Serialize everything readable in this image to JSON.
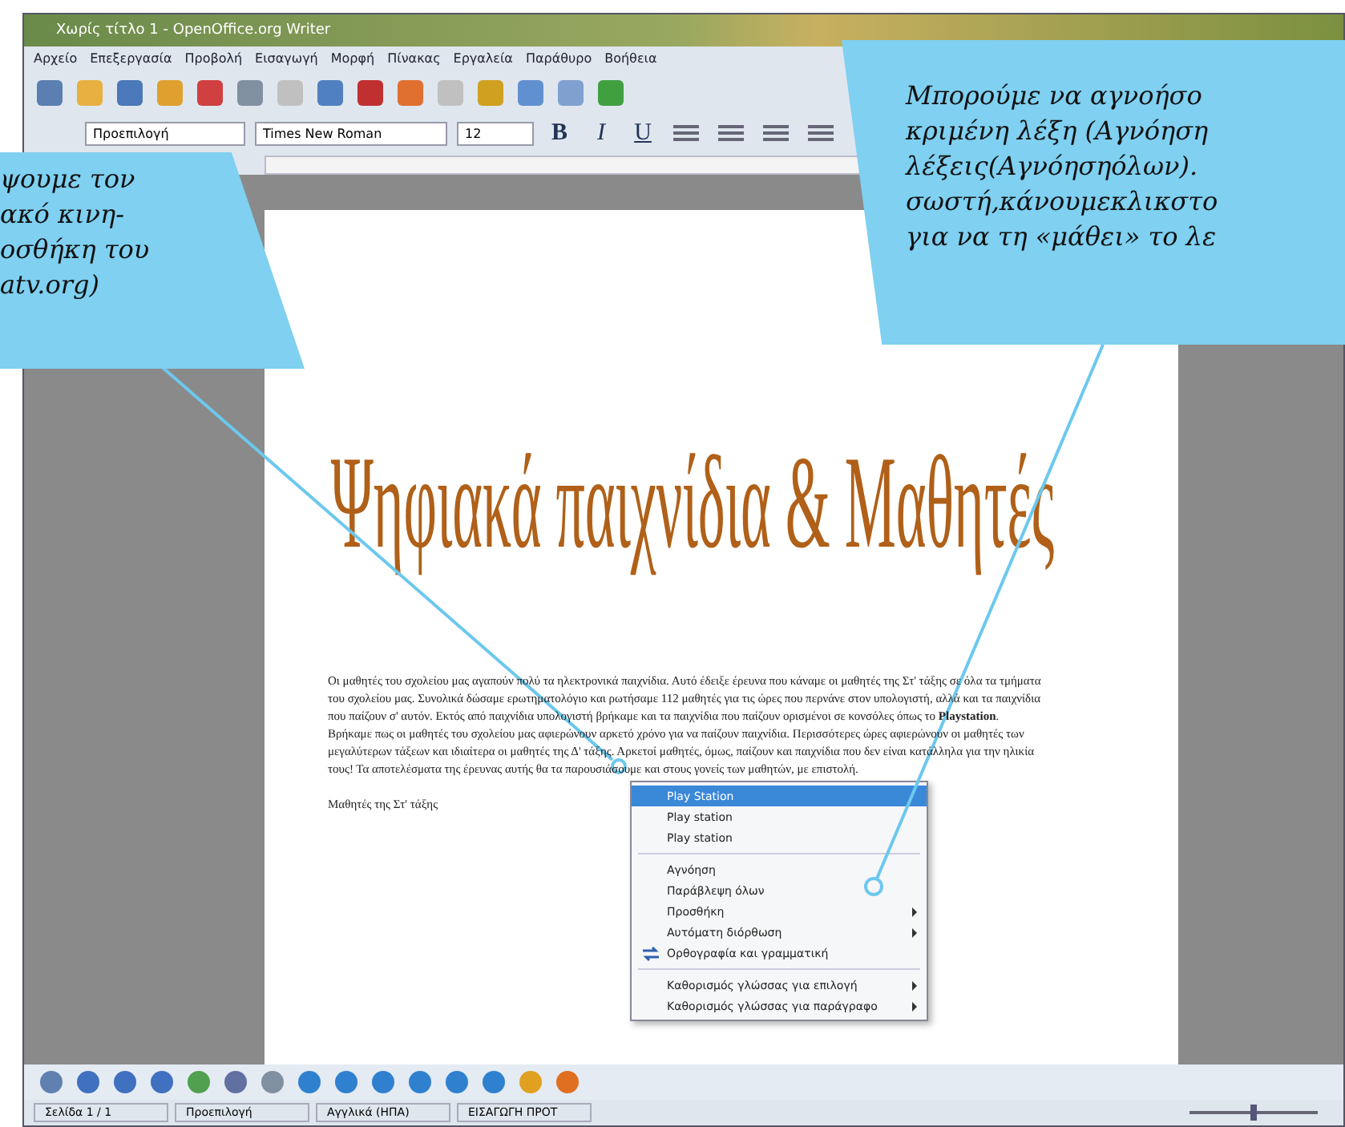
{
  "window": {
    "title": "Χωρίς τίτλο 1 - OpenOffice.org Writer"
  },
  "menu": [
    "Αρχείο",
    "Επεξεργασία",
    "Προβολή",
    "Εισαγωγή",
    "Μορφή",
    "Πίνακας",
    "Εργαλεία",
    "Παράθυρο",
    "Βοήθεια"
  ],
  "format_bar": {
    "style": "Προεπιλογή",
    "font": "Times New Roman",
    "size": "12",
    "style_buttons": [
      "B",
      "I",
      "U"
    ]
  },
  "document": {
    "heading": "Ψηφιακά παιχνίδια & Μαθητές",
    "paragraphs": [
      "Οι μαθητές του σχολείου μας αγαπούν πολύ τα ηλεκτρονικά παιχνίδια. Αυτό έδειξε έρευνα που κάναμε οι μαθητές της Στ' τάξης σε όλα τα τμήματα του σχολείου μας. Συνολικά δώσαμε ερωτηματολόγιο και ρωτήσαμε 112 μαθητές για τις ώρες που περνάνε στον υπολογιστή, αλλά και τα παιχνίδια που παίζουν σ' αυτόν. Εκτός από παιχνίδια υπολογιστή βρήκαμε και τα παιχνίδια που παίζουν ορισμένοι σε κονσόλες όπως το **Playstation**.",
      "Βρήκαμε πως οι μαθητές του σχολείου μας αφιερώνουν αρκετό χρόνο για να παίζουν παιχνίδια. Περισσότερες ώρες αφιερώνουν οι μαθητές των μεγαλύτερων τάξεων και ιδιαίτερα οι μαθητές της Δ' τάξης. Αρκετοί μαθητές, όμως, παίζουν και παιχνίδια που δεν είναι κατάλληλα για την ηλικία τους! Τα αποτελέσματα της έρευνας αυτής θα τα παρουσιάσουμε και στους γονείς των μαθητών, με επιστολή.",
      "Μαθητές της Στ' τάξης"
    ]
  },
  "context_menu": {
    "items": [
      {
        "kind": "suggestion",
        "label": "Play Station",
        "selected": true,
        "submenu": false
      },
      {
        "kind": "suggestion",
        "label": "Play station",
        "selected": false,
        "submenu": false
      },
      {
        "kind": "suggestion",
        "label": "Play station",
        "selected": false,
        "submenu": false
      },
      {
        "kind": "separator"
      },
      {
        "kind": "command",
        "label": "Αγνόηση",
        "selected": false,
        "submenu": false
      },
      {
        "kind": "command",
        "label": "Παράβλεψη όλων",
        "selected": false,
        "submenu": false
      },
      {
        "kind": "command",
        "label": "Προσθήκη",
        "selected": false,
        "submenu": true
      },
      {
        "kind": "command",
        "label": "Αυτόματη διόρθωση",
        "selected": false,
        "submenu": true
      },
      {
        "kind": "spellcheck",
        "label": "Ορθογραφία και γραμματική",
        "selected": false,
        "submenu": false
      },
      {
        "kind": "separator"
      },
      {
        "kind": "command",
        "label": "Καθορισμός γλώσσας για επιλογή",
        "selected": false,
        "submenu": true
      },
      {
        "kind": "command",
        "label": "Καθορισμός γλώσσας για παράγραφο",
        "selected": false,
        "submenu": true
      }
    ]
  },
  "status_bar": [
    "Σελίδα 1 / 1",
    "Προεπιλογή",
    "Αγγλικά (ΗΠΑ)",
    "ΕΙΣΑΓΩΓΗ ΠΡΟΤ"
  ],
  "zoom_slider": {
    "level": 0.5
  },
  "callouts": [
    {
      "lines": [
        "ψουμε τον",
        "ακό κινη-",
        "οσθήκη του",
        "atv.org)"
      ]
    },
    {
      "lines": [
        "Μπορούμε να αγνοήσο",
        "κριμένη λέξη (Αγνόηση",
        "λέξεις(Αγνόησηόλων).",
        "σωστή,κάνουμεκλικστο",
        "για να τη «μάθει» το λε"
      ]
    }
  ]
}
